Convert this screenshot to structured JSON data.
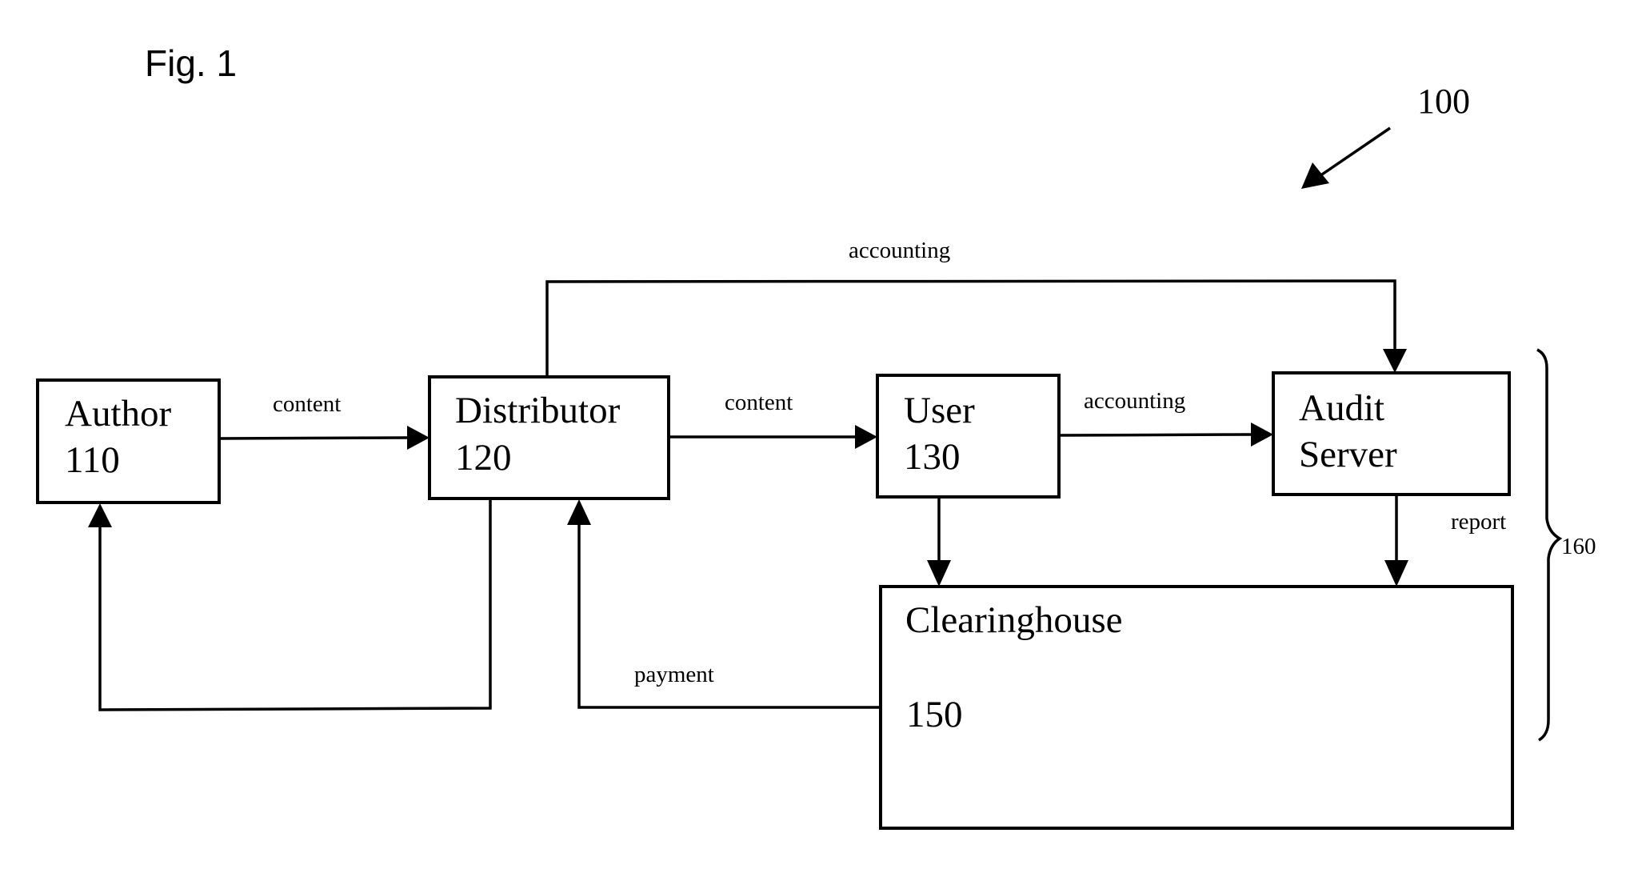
{
  "figure": {
    "title": "Fig. 1",
    "system_ref": "100",
    "group_ref": "160"
  },
  "nodes": {
    "author": {
      "name": "Author",
      "ref": "110"
    },
    "distributor": {
      "name": "Distributor",
      "ref": "120"
    },
    "user": {
      "name": "User",
      "ref": "130"
    },
    "audit_server": {
      "name_line1": "Audit",
      "name_line2": "Server"
    },
    "clearinghouse": {
      "name": "Clearinghouse",
      "ref": "150"
    }
  },
  "edges": {
    "author_to_distributor": {
      "label": "content",
      "from": "Author",
      "to": "Distributor"
    },
    "distributor_to_user": {
      "label": "content",
      "from": "Distributor",
      "to": "User"
    },
    "user_to_audit": {
      "label": "accounting",
      "from": "User",
      "to": "Audit Server"
    },
    "distributor_to_audit": {
      "label": "accounting",
      "from": "Distributor",
      "to": "Audit Server"
    },
    "audit_to_clearinghouse": {
      "label": "report",
      "from": "Audit Server",
      "to": "Clearinghouse"
    },
    "clearinghouse_to_distributor": {
      "label": "payment",
      "from": "Clearinghouse",
      "to": "Distributor"
    },
    "user_to_clearinghouse": {
      "label": "",
      "from": "User",
      "to": "Clearinghouse"
    },
    "distributor_to_author": {
      "label": "",
      "from": "Distributor",
      "to": "Author"
    }
  }
}
